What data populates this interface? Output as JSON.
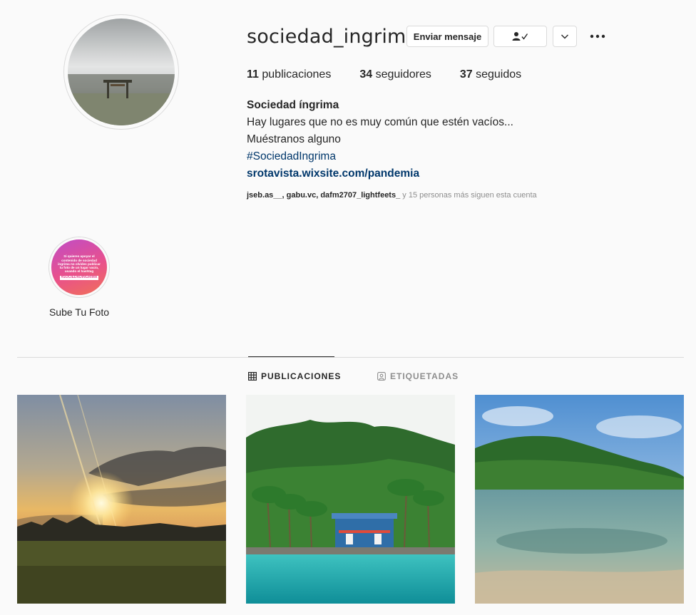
{
  "profile": {
    "username": "sociedad_ingrima",
    "message_button": "Enviar mensaje",
    "follow_icon": "person-check-icon",
    "dropdown_icon": "chevron-down-icon",
    "more_icon": "more-dots-icon",
    "stats": {
      "posts_count": "11",
      "posts_label": " publicaciones",
      "followers_count": "34",
      "followers_label": " seguidores",
      "following_count": "37",
      "following_label": " seguidos"
    },
    "bio": {
      "name": "Sociedad íngrima",
      "line1": "Hay lugares que no es muy común que estén vacíos...",
      "line2": "Muéstranos alguno",
      "hashtag": "#SociedadIngrima",
      "website": "srotavista.wixsite.com/pandemia"
    },
    "followed_by": {
      "names": "jseb.as__, gabu.vc, dafm2707_lightfeets_",
      "rest": " y 15 personas más siguen esta cuenta"
    }
  },
  "highlight": {
    "label": "Sube Tu Foto",
    "image_text": "Si quieres apoyar el contenido de sociedad ingrima no olvides publicar tu foto de un lugar vacio, usando el hashtag",
    "image_tag": "#SOCIEDADINGRIMA"
  },
  "tabs": [
    {
      "label": "PUBLICACIONES",
      "icon": "grid-icon",
      "active": true
    },
    {
      "label": "ETIQUETADAS",
      "icon": "tagged-icon",
      "active": false
    }
  ],
  "colors": {
    "link": "#00376b",
    "border": "#dbdbdb",
    "secondary_text": "#8e8e8e",
    "background": "#fafafa"
  }
}
